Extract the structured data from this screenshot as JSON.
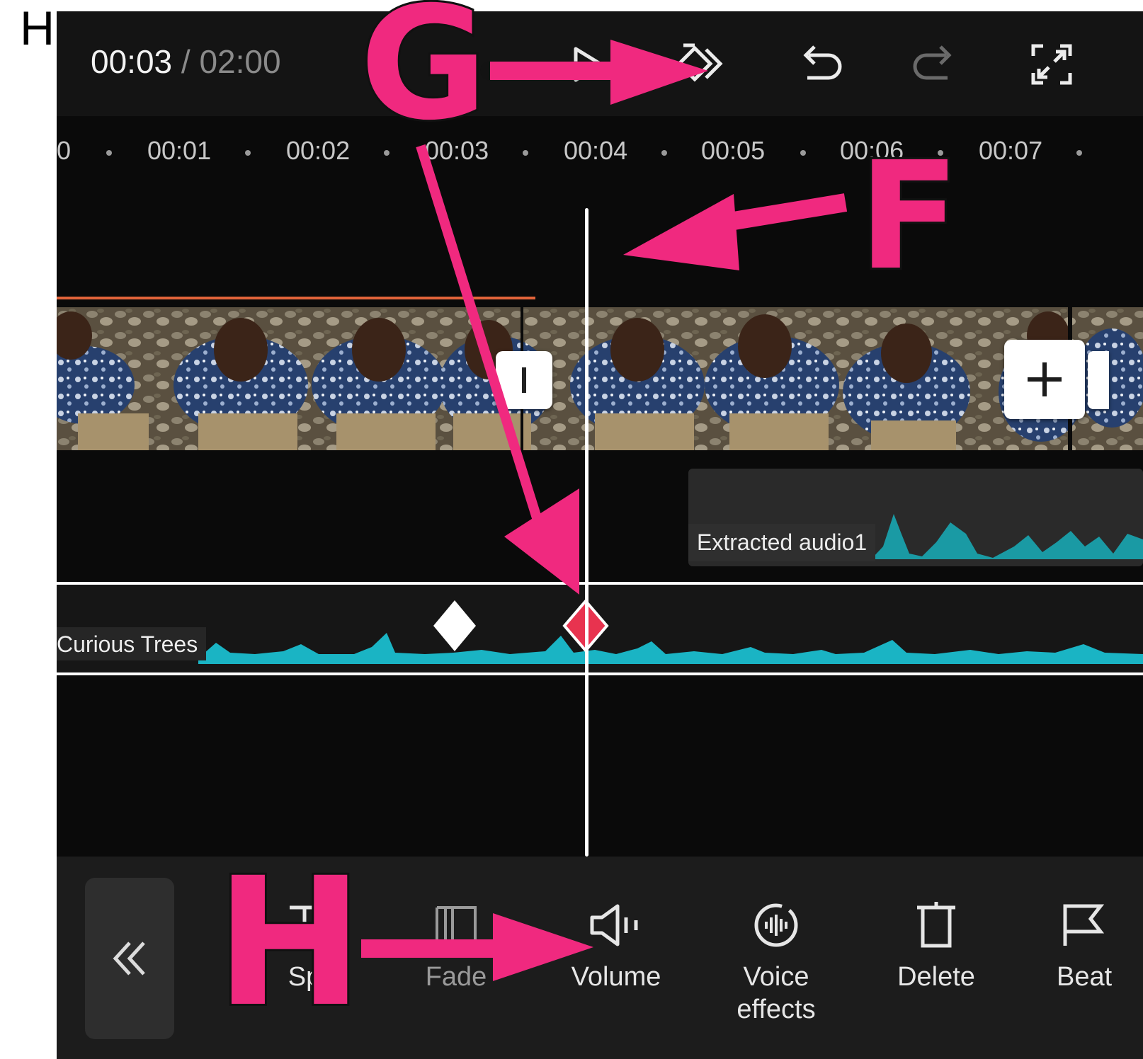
{
  "page_heading": "H",
  "player": {
    "current_time": "00:03",
    "separator": " / ",
    "total_time": "02:00"
  },
  "ruler": {
    "ticks": [
      "0",
      "00:01",
      "00:02",
      "00:03",
      "00:04",
      "00:05",
      "00:06",
      "00:07"
    ]
  },
  "tracks": {
    "extracted_audio_label": "Extracted audio1",
    "music_label": "Curious Trees"
  },
  "toolbar": {
    "tools": [
      {
        "label": "Sp",
        "icon": "split-icon"
      },
      {
        "label": "Fade",
        "icon": "fade-icon"
      },
      {
        "label": "Volume",
        "icon": "volume-icon"
      },
      {
        "label": "Voice\neffects",
        "icon": "voice-effects-icon"
      },
      {
        "label": "Delete",
        "icon": "delete-icon"
      },
      {
        "label": "Beat",
        "icon": "beat-flag-icon"
      }
    ]
  },
  "callouts": {
    "g": "G",
    "f": "F",
    "h": "H"
  },
  "colors": {
    "callout": "#f0297f",
    "waveform": "#1ab4c4",
    "extracted_waveform": "#1a9aa4",
    "keyframe_active": "#e8334f",
    "keyframe": "#ffffff",
    "selection_line": "#e2643a"
  }
}
